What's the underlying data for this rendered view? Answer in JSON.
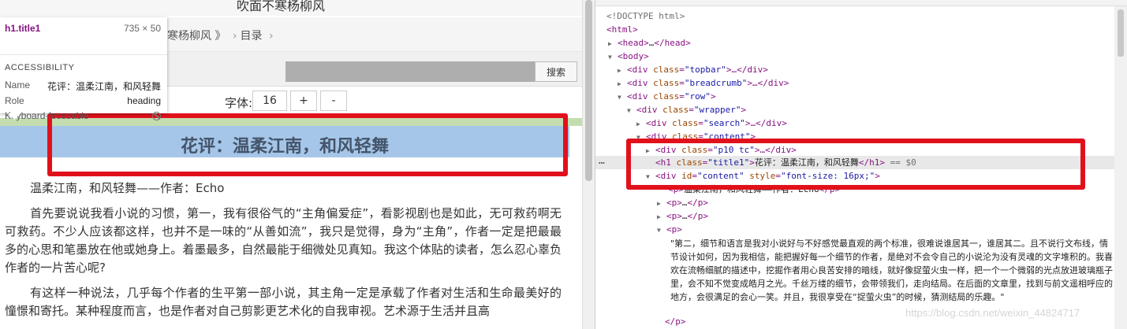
{
  "page": {
    "site_title": "吹面不寒杨柳风",
    "breadcrumb": {
      "book": "寒杨柳风 》",
      "sep": "›",
      "toc": "目录",
      "toc_sep": "›"
    },
    "search": {
      "button": "搜索",
      "value": ""
    },
    "font": {
      "label": "字体:",
      "size": "16",
      "plus": "+",
      "minus": "-"
    },
    "chapter_title": "花评：温柔江南，和风轻舞",
    "paragraphs": [
      "温柔江南，和风轻舞——作者：Echo",
      "首先要说说我看小说的习惯，第一，我有很俗气的“主角偏爱症”，看影视剧也是如此，无可救药啊无可救药。不少人应该都这样，也并不是一味的“从善如流”，我只是觉得，身为“主角”，作者一定是把最最多的心思和笔墨放在他或她身上。着墨最多，自然最能于细微处见真知。我这个体贴的读者，怎么忍心辜负作者的一片苦心呢?",
      "有这样一种说法，几乎每个作者的生平第一部小说，其主角一定是承载了作者对生活和生命最美好的憧憬和寄托。某种程度而言，也是作者对自己剪影更艺术化的自我审视。艺术源于生活并且高"
    ]
  },
  "tooltip": {
    "selector": "h1.title1",
    "dims": "735 × 50",
    "section": "ACCESSIBILITY",
    "rows": [
      {
        "key": "Name",
        "value": "花评：温柔江南，和风轻舞"
      },
      {
        "key": "Role",
        "value": "heading"
      },
      {
        "key": "Keyboard-focusable",
        "value": ""
      }
    ],
    "focusable_icon": "not-allowed-icon"
  },
  "devtools": {
    "ellipsis": "…",
    "lines": [
      {
        "text": "<!DOCTYPE html>",
        "kind": "muted"
      },
      {
        "text": "<html>",
        "kind": "tag"
      },
      {
        "tri": "▶",
        "tag_open": "<head>",
        "middle": "…",
        "tag_close": "</head>"
      },
      {
        "tri": "▼",
        "tag_open": "<body>"
      },
      {
        "tri": "▶",
        "tag_open": "<div ",
        "attr": "class",
        "val": "\"topbar\"",
        "rest": ">…</div>"
      },
      {
        "tri": "▶",
        "tag_open": "<div ",
        "attr": "class",
        "val": "\"breadcrumb\"",
        "rest": ">…</div>"
      },
      {
        "tri": "▼",
        "tag_open": "<div ",
        "attr": "class",
        "val": "\"row\"",
        "rest": ">"
      },
      {
        "tri": "▼",
        "tag_open": "<div ",
        "attr": "class",
        "val": "\"wrapper\"",
        "rest": ">"
      },
      {
        "tri": "▶",
        "tag_open": "<div ",
        "attr": "class",
        "val": "\"search\"",
        "rest": ">…</div>"
      },
      {
        "tri": "▼",
        "tag_open": "<div ",
        "attr": "class",
        "val": "\"content\"",
        "rest": ">"
      },
      {
        "tri": "▶",
        "tag_open": "<div ",
        "attr": "class",
        "val": "\"p10 tc\"",
        "rest": ">…</div>"
      },
      {
        "tri": "",
        "tag_open": "<h1 ",
        "attr": "class",
        "val": "\"title1\"",
        "rest": ">",
        "text": "花评：温柔江南，和风轻舞",
        "close": "</h1>",
        "eq": " == $0"
      },
      {
        "tri": "▼",
        "tag_open": "<div ",
        "attr": "id",
        "val": "\"content\"",
        "attr2": "style",
        "val2": "\"font-size: 16px;\"",
        "rest": ">"
      },
      {
        "tri": "",
        "tag_open": "<p>",
        "text": "温柔江南，和风轻舞——作者：Echo",
        "close": "</p>"
      },
      {
        "tri": "▶",
        "tag_open": "<p>",
        "middle": "…",
        "tag_close": "</p>"
      },
      {
        "tri": "▶",
        "tag_open": "<p>",
        "middle": "…",
        "tag_close": "</p>"
      },
      {
        "tri": "▼",
        "tag_open": "<p>"
      },
      {
        "tag_open": "</p>"
      }
    ],
    "p_text": "\"第二，细节和语言是我对小说好与不好感觉最直观的两个标准，很难说谁居其一，谁居其二。且不说行文布线，情节设计如何，因为我相信，能把握好每一个细节的作者，是绝对不会令自己的小说沦为没有灵魂的文字堆积的。我喜欢在流畅细腻的描述中，挖掘作者用心良苦安排的暗线，就好像捉萤火虫一样，把一个一个微弱的光点放进玻璃瓶子里，会不知不觉变成皓月之光。千丝万缕的细节，会带领我们，走向结局。在后面的文章里，找到与前文遥相呼应的地方，会很满足的会心一笑。并且，我很享受在“捉萤火虫”的时候，猜测结局的乐趣。\"",
    "watermark": "https://blog.csdn.net/weixin_44824717"
  },
  "colors": {
    "highlight_red": "#e1111c",
    "title_band": "#a5c6e8",
    "tag": "#881280",
    "attr": "#994500",
    "value": "#1a1aa6"
  }
}
